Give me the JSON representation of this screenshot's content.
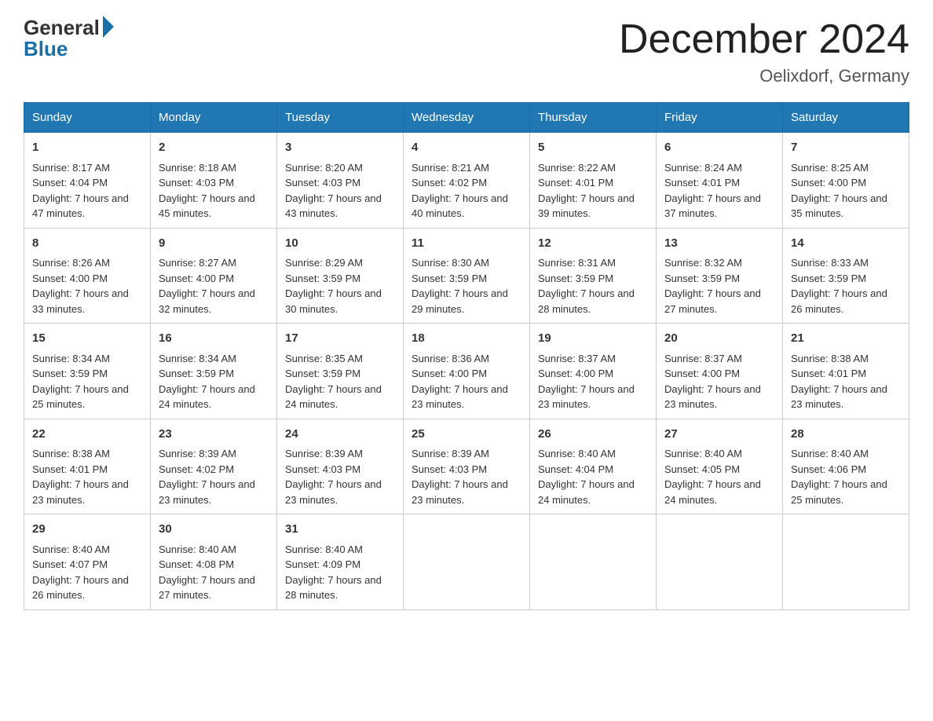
{
  "header": {
    "logo_general": "General",
    "logo_blue": "Blue",
    "month_title": "December 2024",
    "location": "Oelixdorf, Germany"
  },
  "days_of_week": [
    "Sunday",
    "Monday",
    "Tuesday",
    "Wednesday",
    "Thursday",
    "Friday",
    "Saturday"
  ],
  "weeks": [
    [
      {
        "day": "1",
        "sunrise": "Sunrise: 8:17 AM",
        "sunset": "Sunset: 4:04 PM",
        "daylight": "Daylight: 7 hours and 47 minutes."
      },
      {
        "day": "2",
        "sunrise": "Sunrise: 8:18 AM",
        "sunset": "Sunset: 4:03 PM",
        "daylight": "Daylight: 7 hours and 45 minutes."
      },
      {
        "day": "3",
        "sunrise": "Sunrise: 8:20 AM",
        "sunset": "Sunset: 4:03 PM",
        "daylight": "Daylight: 7 hours and 43 minutes."
      },
      {
        "day": "4",
        "sunrise": "Sunrise: 8:21 AM",
        "sunset": "Sunset: 4:02 PM",
        "daylight": "Daylight: 7 hours and 40 minutes."
      },
      {
        "day": "5",
        "sunrise": "Sunrise: 8:22 AM",
        "sunset": "Sunset: 4:01 PM",
        "daylight": "Daylight: 7 hours and 39 minutes."
      },
      {
        "day": "6",
        "sunrise": "Sunrise: 8:24 AM",
        "sunset": "Sunset: 4:01 PM",
        "daylight": "Daylight: 7 hours and 37 minutes."
      },
      {
        "day": "7",
        "sunrise": "Sunrise: 8:25 AM",
        "sunset": "Sunset: 4:00 PM",
        "daylight": "Daylight: 7 hours and 35 minutes."
      }
    ],
    [
      {
        "day": "8",
        "sunrise": "Sunrise: 8:26 AM",
        "sunset": "Sunset: 4:00 PM",
        "daylight": "Daylight: 7 hours and 33 minutes."
      },
      {
        "day": "9",
        "sunrise": "Sunrise: 8:27 AM",
        "sunset": "Sunset: 4:00 PM",
        "daylight": "Daylight: 7 hours and 32 minutes."
      },
      {
        "day": "10",
        "sunrise": "Sunrise: 8:29 AM",
        "sunset": "Sunset: 3:59 PM",
        "daylight": "Daylight: 7 hours and 30 minutes."
      },
      {
        "day": "11",
        "sunrise": "Sunrise: 8:30 AM",
        "sunset": "Sunset: 3:59 PM",
        "daylight": "Daylight: 7 hours and 29 minutes."
      },
      {
        "day": "12",
        "sunrise": "Sunrise: 8:31 AM",
        "sunset": "Sunset: 3:59 PM",
        "daylight": "Daylight: 7 hours and 28 minutes."
      },
      {
        "day": "13",
        "sunrise": "Sunrise: 8:32 AM",
        "sunset": "Sunset: 3:59 PM",
        "daylight": "Daylight: 7 hours and 27 minutes."
      },
      {
        "day": "14",
        "sunrise": "Sunrise: 8:33 AM",
        "sunset": "Sunset: 3:59 PM",
        "daylight": "Daylight: 7 hours and 26 minutes."
      }
    ],
    [
      {
        "day": "15",
        "sunrise": "Sunrise: 8:34 AM",
        "sunset": "Sunset: 3:59 PM",
        "daylight": "Daylight: 7 hours and 25 minutes."
      },
      {
        "day": "16",
        "sunrise": "Sunrise: 8:34 AM",
        "sunset": "Sunset: 3:59 PM",
        "daylight": "Daylight: 7 hours and 24 minutes."
      },
      {
        "day": "17",
        "sunrise": "Sunrise: 8:35 AM",
        "sunset": "Sunset: 3:59 PM",
        "daylight": "Daylight: 7 hours and 24 minutes."
      },
      {
        "day": "18",
        "sunrise": "Sunrise: 8:36 AM",
        "sunset": "Sunset: 4:00 PM",
        "daylight": "Daylight: 7 hours and 23 minutes."
      },
      {
        "day": "19",
        "sunrise": "Sunrise: 8:37 AM",
        "sunset": "Sunset: 4:00 PM",
        "daylight": "Daylight: 7 hours and 23 minutes."
      },
      {
        "day": "20",
        "sunrise": "Sunrise: 8:37 AM",
        "sunset": "Sunset: 4:00 PM",
        "daylight": "Daylight: 7 hours and 23 minutes."
      },
      {
        "day": "21",
        "sunrise": "Sunrise: 8:38 AM",
        "sunset": "Sunset: 4:01 PM",
        "daylight": "Daylight: 7 hours and 23 minutes."
      }
    ],
    [
      {
        "day": "22",
        "sunrise": "Sunrise: 8:38 AM",
        "sunset": "Sunset: 4:01 PM",
        "daylight": "Daylight: 7 hours and 23 minutes."
      },
      {
        "day": "23",
        "sunrise": "Sunrise: 8:39 AM",
        "sunset": "Sunset: 4:02 PM",
        "daylight": "Daylight: 7 hours and 23 minutes."
      },
      {
        "day": "24",
        "sunrise": "Sunrise: 8:39 AM",
        "sunset": "Sunset: 4:03 PM",
        "daylight": "Daylight: 7 hours and 23 minutes."
      },
      {
        "day": "25",
        "sunrise": "Sunrise: 8:39 AM",
        "sunset": "Sunset: 4:03 PM",
        "daylight": "Daylight: 7 hours and 23 minutes."
      },
      {
        "day": "26",
        "sunrise": "Sunrise: 8:40 AM",
        "sunset": "Sunset: 4:04 PM",
        "daylight": "Daylight: 7 hours and 24 minutes."
      },
      {
        "day": "27",
        "sunrise": "Sunrise: 8:40 AM",
        "sunset": "Sunset: 4:05 PM",
        "daylight": "Daylight: 7 hours and 24 minutes."
      },
      {
        "day": "28",
        "sunrise": "Sunrise: 8:40 AM",
        "sunset": "Sunset: 4:06 PM",
        "daylight": "Daylight: 7 hours and 25 minutes."
      }
    ],
    [
      {
        "day": "29",
        "sunrise": "Sunrise: 8:40 AM",
        "sunset": "Sunset: 4:07 PM",
        "daylight": "Daylight: 7 hours and 26 minutes."
      },
      {
        "day": "30",
        "sunrise": "Sunrise: 8:40 AM",
        "sunset": "Sunset: 4:08 PM",
        "daylight": "Daylight: 7 hours and 27 minutes."
      },
      {
        "day": "31",
        "sunrise": "Sunrise: 8:40 AM",
        "sunset": "Sunset: 4:09 PM",
        "daylight": "Daylight: 7 hours and 28 minutes."
      },
      null,
      null,
      null,
      null
    ]
  ]
}
